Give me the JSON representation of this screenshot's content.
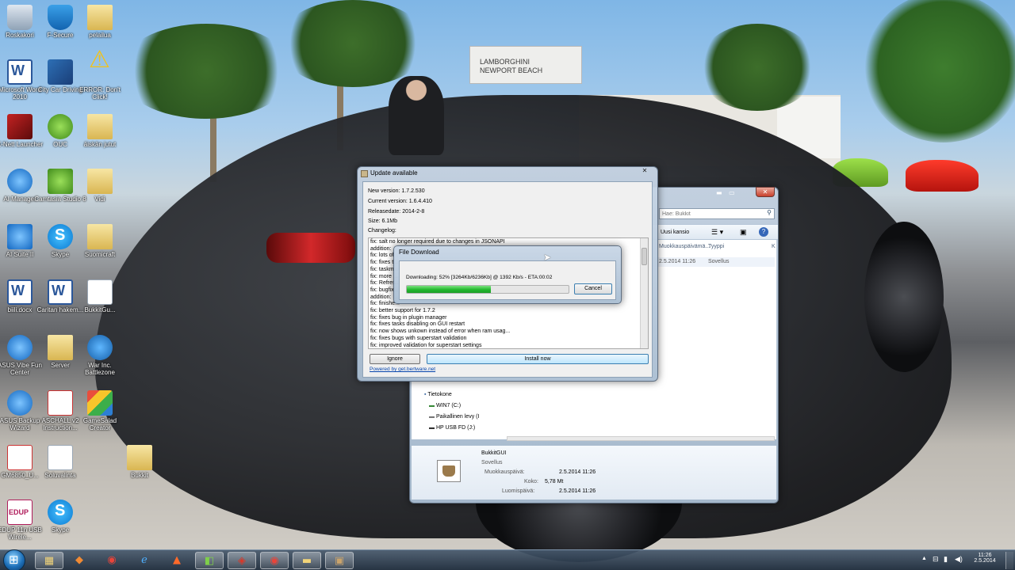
{
  "desktop_icons": [
    {
      "label": "Roskakori",
      "icon": "recycle-bin-icon"
    },
    {
      "label": "F-Secure",
      "icon": "f-secure-icon"
    },
    {
      "label": "pelailua",
      "icon": "folder-icon"
    },
    {
      "label": "Microsoft Word 2010",
      "icon": "word-icon"
    },
    {
      "label": "City Car Driving",
      "icon": "city-car-driving-icon"
    },
    {
      "label": "ERROR: Don't Click!",
      "icon": "warning-icon"
    },
    {
      "label": "X-Nett Launcher",
      "icon": "launcher-icon"
    },
    {
      "label": "OUC",
      "icon": "ouc-icon"
    },
    {
      "label": "äiskän jutut",
      "icon": "folder-icon"
    },
    {
      "label": "AI Manager",
      "icon": "ai-manager-icon"
    },
    {
      "label": "Camtasia Studio 8",
      "icon": "camtasia-icon"
    },
    {
      "label": "Vidi",
      "icon": "folder-icon"
    },
    {
      "label": "AI Suite II",
      "icon": "ai-suite-icon"
    },
    {
      "label": "Skype",
      "icon": "skype-icon"
    },
    {
      "label": "Suomicraft",
      "icon": "folder-icon"
    },
    {
      "label": "biili.docx",
      "icon": "document-icon"
    },
    {
      "label": "Caritan hakem...",
      "icon": "document-icon"
    },
    {
      "label": "BukkitGu...",
      "icon": "document-icon"
    },
    {
      "label": "ASUS Vibe Fun Center",
      "icon": "asus-vibe-icon"
    },
    {
      "label": "Server",
      "icon": "folder-icon"
    },
    {
      "label": "War Inc. Battlezone",
      "icon": "globe-icon"
    },
    {
      "label": "ASUS Backup Wizard",
      "icon": "backup-icon"
    },
    {
      "label": "ASCHALL v2 Instruction...",
      "icon": "pdf-icon"
    },
    {
      "label": "GameSalad Creator",
      "icon": "gamesalad-icon"
    },
    {
      "label": "GM6850_U...",
      "icon": "pdf-icon"
    },
    {
      "label": "Soluvalinta",
      "icon": "document-icon"
    },
    {
      "label": "Bukkit",
      "icon": "folder-icon"
    },
    {
      "label": "EDUP 11n USB Wirele...",
      "icon": "edup-icon"
    },
    {
      "label": "Skype",
      "icon": "skype-icon"
    }
  ],
  "background": {
    "sign_line1": "LAMBORGHINI",
    "sign_line2": "NEWPORT BEACH"
  },
  "explorer": {
    "search_placeholder": "Hae: Bukkit",
    "organize_label": "Uusi kansio",
    "columns": [
      "Muokkauspäivämä...",
      "Tyyppi",
      "K"
    ],
    "row": {
      "date": "2.5.2014 11:26",
      "type": "Sovellus"
    },
    "nav_items": [
      "Tietokone",
      "WIN7 (C:)",
      "Paikallinen levy (I",
      "HP USB FD (J:)"
    ],
    "details": {
      "name": "BukkitGUI",
      "type": "Sovellus",
      "modified_label": "Muokkauspäivä:",
      "modified_value": "2.5.2014 11:26",
      "size_label": "Koko:",
      "size_value": "5,78 Mt",
      "created_label": "Luomispäivä:",
      "created_value": "2.5.2014 11:26"
    }
  },
  "update_dialog": {
    "title": "Update available",
    "new_version": "New version: 1.7.2.530",
    "current_version": "Current version: 1.6.4.410",
    "release_date": "Releasedate: 2014-2-8",
    "size": "Size: 6.1Mb",
    "changelog_label": "Changelog:",
    "changelog": [
      "fix: salt no longer required due to changes in JSONAPI",
      "addition: ...",
      "fix: lots of ...",
      "fix: fixes t...",
      "fix: taskm...",
      "fix: more ...",
      "fix: Refres...",
      "fix: bugfix...",
      "addition: ...",
      "fix: finishe...",
      "fix: better support for 1.7.2",
      "fix: fixes bug in plugin manager",
      "fix: fixes tasks disabling on GUI restart",
      "fix: now shows unkown instead of error when ram usag...",
      "fix: fixes bugs with superstart validation",
      "fix: improved validation for superstart settings"
    ],
    "ignore_label": "Ignore",
    "install_label": "Install now",
    "powered_by": "Powered by get.bertware.net"
  },
  "download_dialog": {
    "title": "File Download",
    "status": "Downloading: 52% [3264Kb/6236Kb] @ 1392 Kb/s  -  ETA:00:02",
    "progress_percent": 52,
    "cancel_label": "Cancel"
  },
  "taskbar": {
    "apps": [
      "explorer-icon",
      "ouc-icon",
      "chrome-icon",
      "ie-icon",
      "media-icon",
      "camtasia-icon",
      "recorder-icon",
      "chrome-icon",
      "folder-icon",
      "bukkitgui-icon"
    ],
    "clock_time": "11:26",
    "clock_date": "2.5.2014"
  },
  "colors": {
    "progress_green": "#2fc439",
    "accent_link": "#0645ad"
  }
}
